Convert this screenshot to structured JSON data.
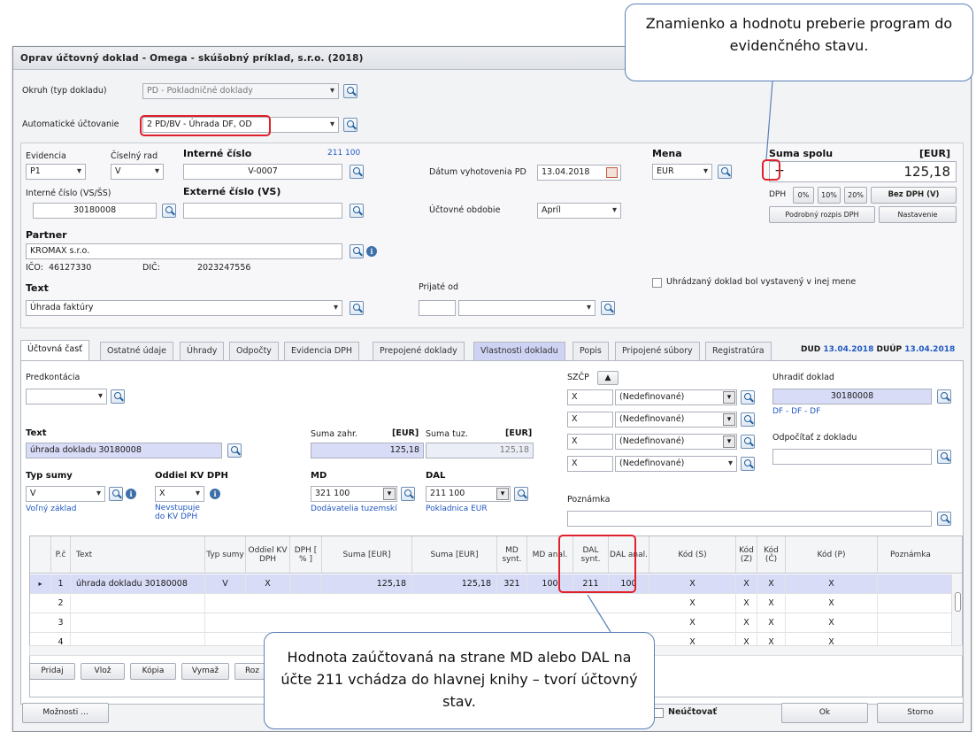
{
  "window_title": "Oprav účtovný doklad - Omega - skúšobný príklad, s.r.o. (2018)",
  "okruh": {
    "label": "Okruh (typ dokladu)",
    "value": "PD - Pokladničné doklady"
  },
  "auto": {
    "label": "Automatické účtovanie",
    "value": "2 PD/BV - Úhrada DF, OD"
  },
  "evidencia": {
    "label": "Evidencia",
    "value": "P1"
  },
  "ciselny_rad": {
    "label": "Číselný rad",
    "value": "V"
  },
  "interne_cislo": {
    "label": "Interné číslo",
    "value": "V-0007",
    "nums": "211 100"
  },
  "interne_vs": {
    "label": "Interné číslo (VS/ŠS)",
    "value": "30180008"
  },
  "externe": {
    "label": "Externé číslo (VS)",
    "value": ""
  },
  "partner": {
    "label": "Partner",
    "value": "KROMAX s.r.o.",
    "ico_label": "IČO:",
    "ico": "46127330",
    "dic_label": "DIČ:",
    "dic": "2023247556"
  },
  "text_top": {
    "label": "Text",
    "value": "Úhrada faktúry"
  },
  "datum": {
    "label": "Dátum vyhotovenia PD",
    "value": "13.04.2018"
  },
  "obdobie": {
    "label": "Účtovné obdobie",
    "value": "Apríl"
  },
  "prijate": {
    "label": "Prijaté od",
    "value": ""
  },
  "mena": {
    "label": "Mena",
    "value": "EUR"
  },
  "suma": {
    "label": "Suma spolu",
    "unit": "[EUR]",
    "sign": "+",
    "value": "125,18",
    "dph_label": "DPH",
    "btn_0": "0%",
    "btn_10": "10%",
    "btn_20": "20%",
    "btn_bez": "Bez DPH (V)",
    "btn_rozpis": "Podrobný rozpis DPH",
    "btn_nastavenie": "Nastavenie"
  },
  "uhradzany": "Uhrádzaný doklad bol vystavený v inej mene",
  "tabs": [
    "Účtovná časť",
    "Ostatné údaje",
    "Úhrady",
    "Odpočty",
    "Evidencia DPH",
    "Prepojené doklady",
    "Vlastnosti dokladu",
    "Popis",
    "Pripojené súbory",
    "Registratúra"
  ],
  "dud_label": "DUD",
  "dud": "13.04.2018",
  "duup_label": "DUÚP",
  "duup": "13.04.2018",
  "predkontacia": {
    "label": "Predkontácia",
    "value": ""
  },
  "text_inner": {
    "label": "Text",
    "value": "úhrada dokladu 30180008"
  },
  "suma_zahr": {
    "label": "Suma zahr.",
    "unit": "[EUR]",
    "value": "125,18"
  },
  "suma_tuz": {
    "label": "Suma tuz.",
    "unit": "[EUR]",
    "value": "125,18"
  },
  "typ_sumy": {
    "label": "Typ sumy",
    "value": "V",
    "desc": "Voľný základ"
  },
  "oddiel": {
    "label": "Oddiel KV DPH",
    "value": "X",
    "desc1": "Nevstupuje",
    "desc2": "do KV DPH"
  },
  "md": {
    "label": "MD",
    "synt": "321",
    "anal": "100",
    "desc": "Dodávatelia tuzemskí"
  },
  "dal": {
    "label": "DAL",
    "synt": "211",
    "anal": "100",
    "desc": "Pokladnica EUR"
  },
  "szcp": {
    "label": "SZČP",
    "rows": [
      {
        "code": "X",
        "val": "(Nedefinované)"
      },
      {
        "code": "X",
        "val": "(Nedefinované)"
      },
      {
        "code": "X",
        "val": "(Nedefinované)"
      },
      {
        "code": "X",
        "val": "(Nedefinované)"
      }
    ]
  },
  "uhradit": {
    "label": "Uhradiť doklad",
    "value": "30180008",
    "sub": "DF - DF - DF"
  },
  "odpocitat": {
    "label": "Odpočítať z dokladu",
    "value": ""
  },
  "poznamka": {
    "label": "Poznámka",
    "value": ""
  },
  "grid": {
    "headers": [
      "P.č",
      "Text",
      "Typ sumy",
      "Oddiel KV DPH",
      "DPH [ % ]",
      "Suma [EUR]",
      "Suma [EUR]",
      "MD synt.",
      "MD anal.",
      "DAL synt.",
      "DAL anal.",
      "Kód (S)",
      "Kód (Z)",
      "Kód (Č)",
      "Kód (P)",
      "Poznámka"
    ],
    "rows": [
      {
        "pc": "1",
        "text": "úhrada dokladu 30180008",
        "typ": "V",
        "oddiel": "X",
        "dph": "",
        "suma1": "125,18",
        "suma2": "125,18",
        "mds": "321",
        "mda": "100",
        "dals": "211",
        "dala": "100",
        "ks": "X",
        "kz": "X",
        "kc": "X",
        "kp": "X",
        "pozn": ""
      },
      {
        "pc": "2",
        "text": "",
        "typ": "",
        "oddiel": "",
        "dph": "",
        "suma1": "",
        "suma2": "",
        "mds": "",
        "mda": "",
        "dals": "",
        "dala": "",
        "ks": "X",
        "kz": "X",
        "kc": "X",
        "kp": "X",
        "pozn": ""
      },
      {
        "pc": "3",
        "text": "",
        "typ": "",
        "oddiel": "",
        "dph": "",
        "suma1": "",
        "suma2": "",
        "mds": "",
        "mda": "",
        "dals": "",
        "dala": "",
        "ks": "X",
        "kz": "X",
        "kc": "X",
        "kp": "X",
        "pozn": ""
      },
      {
        "pc": "4",
        "text": "",
        "typ": "",
        "oddiel": "",
        "dph": "",
        "suma1": "",
        "suma2": "",
        "mds": "",
        "mda": "",
        "dals": "",
        "dala": "",
        "ks": "X",
        "kz": "X",
        "kc": "X",
        "kp": "X",
        "pozn": ""
      }
    ]
  },
  "buttons": {
    "pridaj": "Pridaj",
    "vloz": "Vlož",
    "kopia": "Kópia",
    "vymaz": "Vymaž",
    "roz": "Roz",
    "moznosti": "Možnosti ...",
    "neuctovat": "Neúčtovať",
    "ok": "Ok",
    "storno": "Storno"
  },
  "callouts": {
    "top": "Znamienko a hodnotu preberie program do evidenčného stavu.",
    "bottom": "Hodnota zaúčtovaná na strane MD alebo DAL na účte 211 vchádza do hlavnej knihy – tvorí účtovný stav."
  }
}
